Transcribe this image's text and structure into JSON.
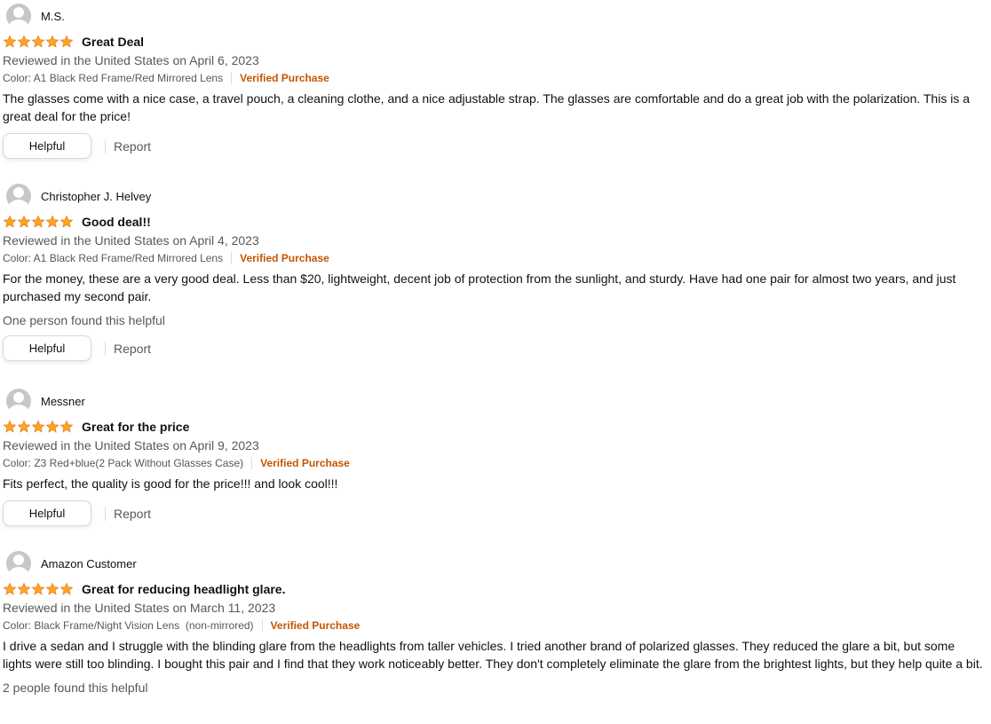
{
  "reviews": [
    {
      "name": "M.S.",
      "rating": 5,
      "title": "Great Deal",
      "date": "Reviewed in the United States on April 6, 2023",
      "variant": "Color: A1 Black Red Frame/Red Mirrored Lens",
      "verified": "Verified Purchase",
      "body": "The glasses come with a nice case, a travel pouch, a cleaning clothe, and a nice adjustable strap. The glasses are comfortable and do a great job with the polarization. This is a great deal for the price!",
      "helpful_count": "",
      "helpful_label": "Helpful",
      "report_label": "Report"
    },
    {
      "name": "Christopher J. Helvey",
      "rating": 5,
      "title": "Good deal!!",
      "date": "Reviewed in the United States on April 4, 2023",
      "variant": "Color: A1 Black Red Frame/Red Mirrored Lens",
      "verified": "Verified Purchase",
      "body": "For the money, these are a very good deal. Less than $20, lightweight, decent job of protection from the sunlight, and sturdy. Have had one pair for almost two years, and just purchased my second pair.",
      "helpful_count": "One person found this helpful",
      "helpful_label": "Helpful",
      "report_label": "Report"
    },
    {
      "name": "Messner",
      "rating": 5,
      "title": "Great for the price",
      "date": "Reviewed in the United States on April 9, 2023",
      "variant": "Color: Z3 Red+blue(2 Pack Without Glasses Case)",
      "verified": "Verified Purchase",
      "body": "Fits perfect, the quality is good for the price!!! and look cool!!!",
      "helpful_count": "",
      "helpful_label": "Helpful",
      "report_label": "Report"
    },
    {
      "name": "Amazon Customer",
      "rating": 5,
      "title": "Great for reducing headlight glare.",
      "date": "Reviewed in the United States on March 11, 2023",
      "variant": "Color: Black Frame/Night Vision Lens  (non-mirrored)",
      "verified": "Verified Purchase",
      "body": "I drive a sedan and I struggle with the blinding glare from the headlights from taller vehicles. I tried another brand of polarized glasses. They reduced the glare a bit, but some lights were still too blinding. I bought this pair and I find that they work noticeably better. They don't completely eliminate the glare from the brightest lights, but they help quite a bit.",
      "helpful_count": "2 people found this helpful",
      "helpful_label": "",
      "report_label": ""
    }
  ],
  "colors": {
    "star": "#ffa41c",
    "star_outline": "#de7921",
    "verified": "#c45500",
    "secondary_text": "#565959"
  },
  "icons": {
    "avatar": "avatar-icon",
    "star": "star-icon"
  }
}
